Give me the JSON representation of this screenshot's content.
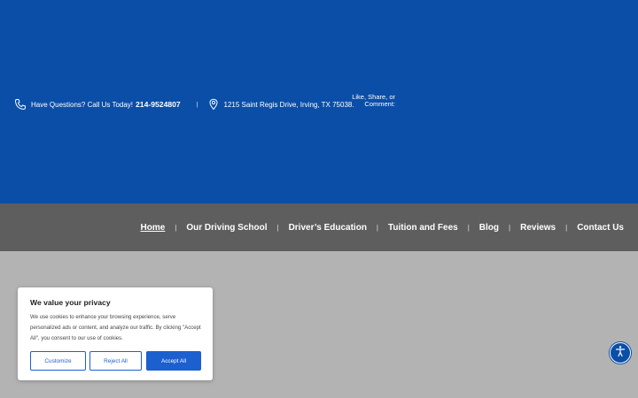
{
  "topbar": {
    "phone_label": "Have Questions? Call Us Today!",
    "phone_number": "214-9524807",
    "address": "1215 Saint Regis Drive, Irving, TX 75038.",
    "social_line1": "Like, Share, or",
    "social_line2": "Comment:",
    "colors": {
      "background": "#0a4ea8"
    }
  },
  "nav": {
    "items": [
      {
        "label": "Home",
        "active": true
      },
      {
        "label": "Our Driving School"
      },
      {
        "label": "Driver’s Education"
      },
      {
        "label": "Tuition and Fees"
      },
      {
        "label": "Blog"
      },
      {
        "label": "Reviews"
      },
      {
        "label": "Contact Us"
      }
    ],
    "colors": {
      "background": "#5e5e5e"
    }
  },
  "cookie_banner": {
    "title": "We value your privacy",
    "text": "We use cookies to enhance your browsing experience, serve personalized ads or content, and analyze our traffic. By clicking \"Accept All\", you consent to our use of cookies.",
    "customize_label": "Customize",
    "reject_label": "Reject All",
    "accept_label": "Accept All",
    "colors": {
      "accent": "#1c5fcf"
    }
  },
  "icons": {
    "phone": "phone-icon",
    "location": "location-pin-icon",
    "accessibility": "accessibility-icon"
  }
}
